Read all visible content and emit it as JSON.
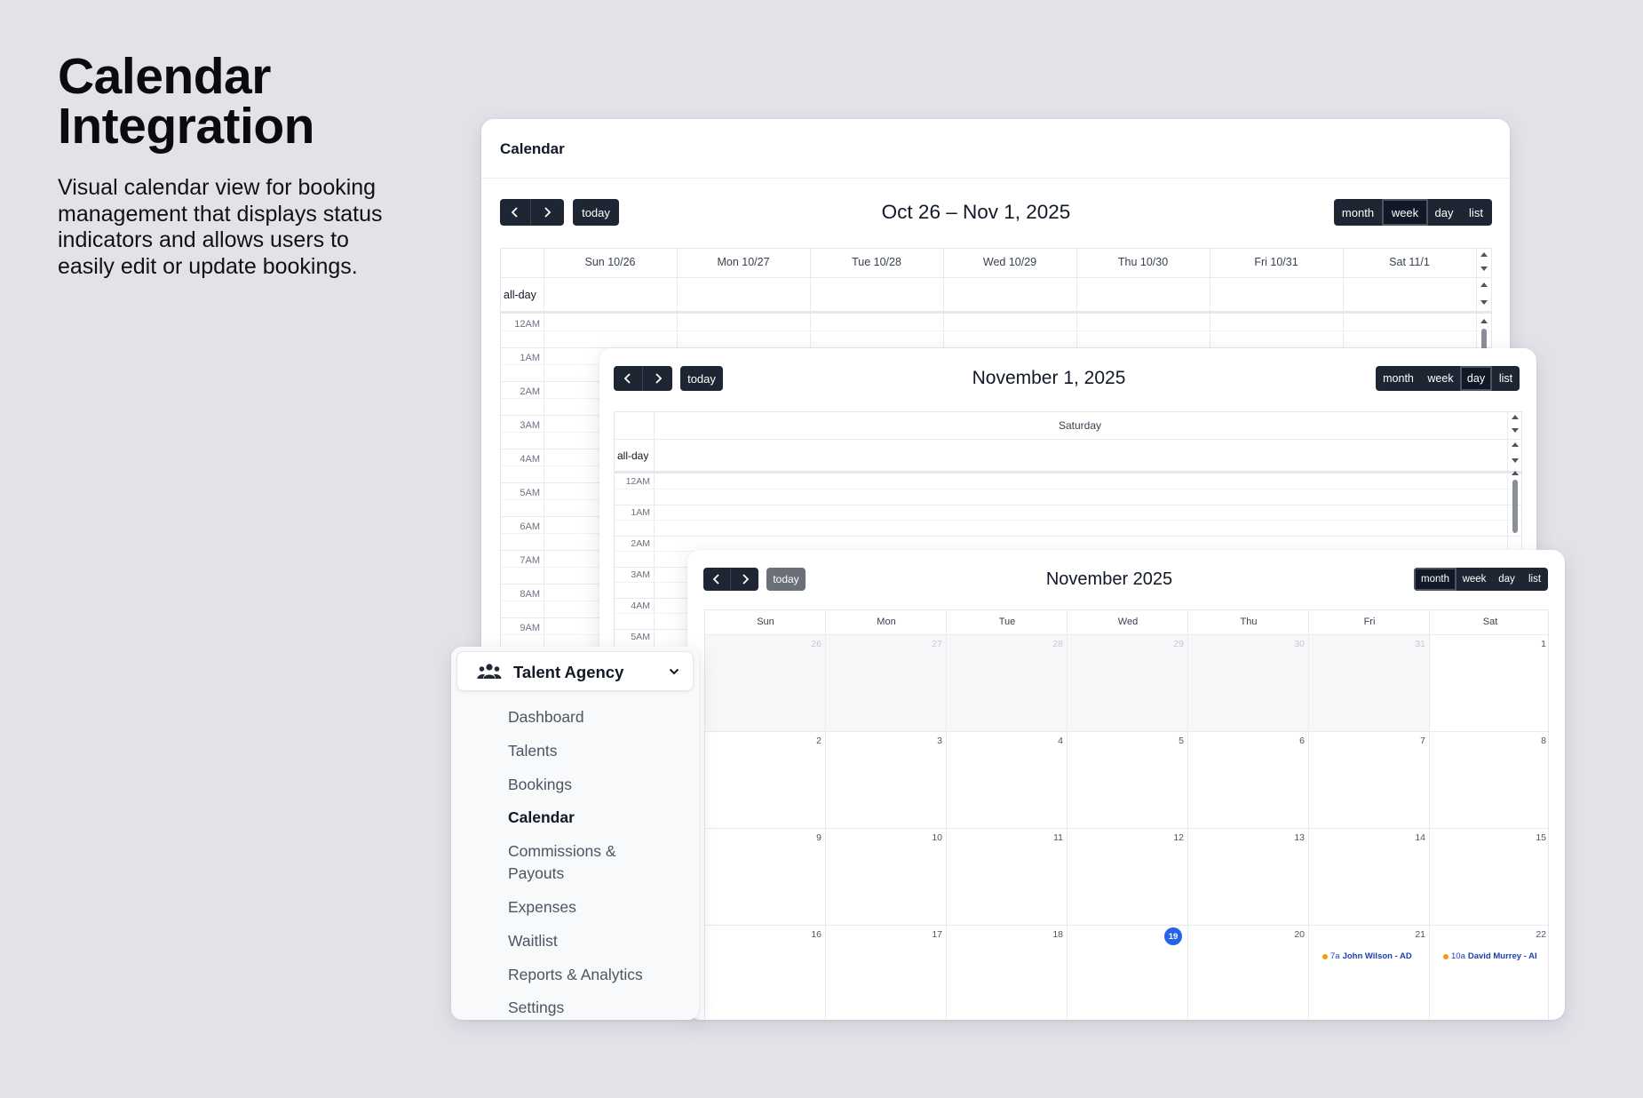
{
  "hero": {
    "title_line1": "Calendar",
    "title_line2": "Integration",
    "description": "Visual calendar view for booking management that displays status indicators and allows users to easily edit or update bookings."
  },
  "week_panel": {
    "header": "Calendar",
    "today_label": "today",
    "title": "Oct 26 – Nov 1, 2025",
    "views": [
      "month",
      "week",
      "day",
      "list"
    ],
    "active_view": "week",
    "days": [
      "Sun 10/26",
      "Mon 10/27",
      "Tue 10/28",
      "Wed 10/29",
      "Thu 10/30",
      "Fri 10/31",
      "Sat 11/1"
    ],
    "allday_label": "all-day",
    "times": [
      "12AM",
      "1AM",
      "2AM",
      "3AM",
      "4AM",
      "5AM",
      "6AM",
      "7AM",
      "8AM",
      "9AM"
    ]
  },
  "day_panel": {
    "today_label": "today",
    "title": "November 1, 2025",
    "views": [
      "month",
      "week",
      "day",
      "list"
    ],
    "active_view": "day",
    "day_header": "Saturday",
    "allday_label": "all-day",
    "times": [
      "12AM",
      "1AM",
      "2AM",
      "3AM",
      "4AM",
      "5AM"
    ]
  },
  "month_panel": {
    "today_label": "today",
    "title": "November 2025",
    "views": [
      "month",
      "week",
      "day",
      "list"
    ],
    "active_view": "month",
    "weekdays": [
      "Sun",
      "Mon",
      "Tue",
      "Wed",
      "Thu",
      "Fri",
      "Sat"
    ],
    "weeks": [
      [
        "26",
        "27",
        "28",
        "29",
        "30",
        "31",
        "1"
      ],
      [
        "2",
        "3",
        "4",
        "5",
        "6",
        "7",
        "8"
      ],
      [
        "9",
        "10",
        "11",
        "12",
        "13",
        "14",
        "15"
      ],
      [
        "16",
        "17",
        "18",
        "19",
        "20",
        "21",
        "22"
      ]
    ],
    "today_date": "19",
    "events": [
      {
        "time": "7a",
        "title": "John Wilson - AD"
      },
      {
        "time": "10a",
        "title": "David Murrey - AI"
      }
    ],
    "colors": {
      "today": "#2563eb",
      "event_dot": "#f59e0b",
      "event_text": "#1e40af"
    }
  },
  "sidebar": {
    "section_icon": "users-icon",
    "section_label": "Talent Agency",
    "items": [
      "Dashboard",
      "Talents",
      "Bookings",
      "Calendar",
      "Commissions &",
      "Payouts",
      "Expenses",
      "Waitlist",
      "Reports & Analytics",
      "Settings"
    ],
    "active_item": "Calendar"
  }
}
